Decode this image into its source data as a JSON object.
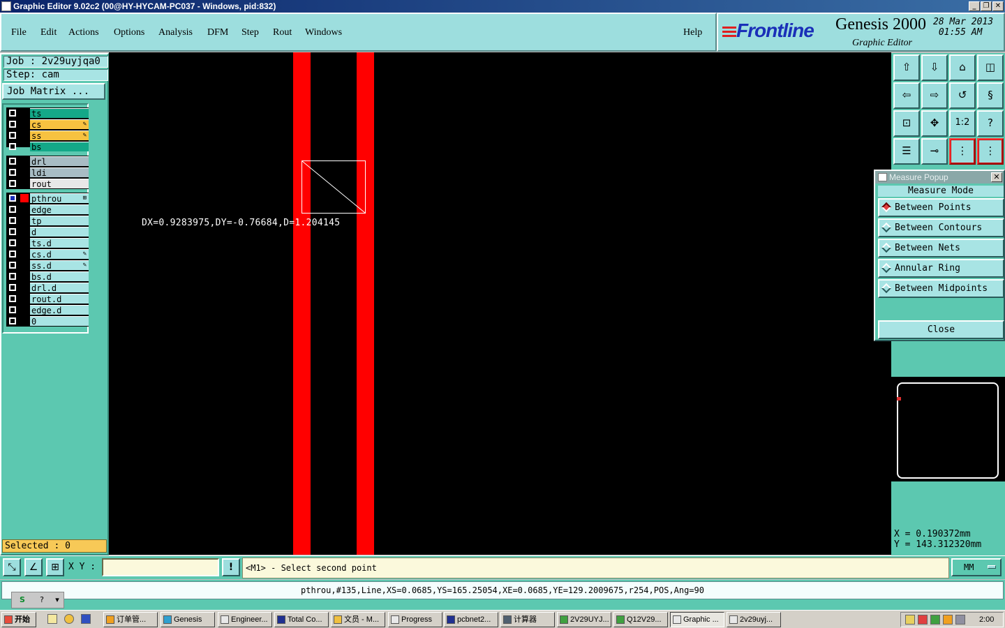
{
  "window": {
    "title": "Graphic Editor 9.02c2 (00@HY-HYCAM-PC037 - Windows, pid:832)"
  },
  "menu": {
    "items": [
      "File",
      "Edit",
      "Actions",
      "Options",
      "Analysis",
      "DFM",
      "Step",
      "Rout",
      "Windows"
    ],
    "help": "Help"
  },
  "brand": {
    "logo": "Frontline",
    "product": "Genesis 2000",
    "date": "28 Mar 2013",
    "time": "01:55 AM",
    "subtitle": "Graphic Editor"
  },
  "job": {
    "job_label": "Job : 2v29uyjqa0",
    "step_label": "Step: cam",
    "matrix_button": "Job Matrix ..."
  },
  "layers": {
    "group1": [
      {
        "name": "ts",
        "color": "#14a888",
        "mark": ""
      },
      {
        "name": "cs",
        "color": "#f7c240",
        "mark": "✎"
      },
      {
        "name": "ss",
        "color": "#f7c240",
        "mark": "✎"
      },
      {
        "name": "bs",
        "color": "#14a888",
        "mark": ""
      }
    ],
    "group2": [
      {
        "name": "drl",
        "color": "#a8bcc4",
        "mark": ""
      },
      {
        "name": "ldi",
        "color": "#a8bcc4",
        "mark": ""
      },
      {
        "name": "rout",
        "color": "#e8e8e8",
        "mark": ""
      }
    ],
    "group3": [
      {
        "name": "pthrou",
        "color": "#a8e4e4",
        "mark": "⊞"
      },
      {
        "name": "edge",
        "color": "#a8e4e4",
        "mark": ""
      },
      {
        "name": "tp",
        "color": "#a8e4e4",
        "mark": ""
      },
      {
        "name": "d",
        "color": "#a8e4e4",
        "mark": ""
      },
      {
        "name": "ts.d",
        "color": "#a8e4e4",
        "mark": ""
      },
      {
        "name": "cs.d",
        "color": "#a8e4e4",
        "mark": "✎"
      },
      {
        "name": "ss.d",
        "color": "#a8e4e4",
        "mark": "✎"
      },
      {
        "name": "bs.d",
        "color": "#a8e4e4",
        "mark": ""
      },
      {
        "name": "drl.d",
        "color": "#a8e4e4",
        "mark": ""
      },
      {
        "name": "rout.d",
        "color": "#a8e4e4",
        "mark": ""
      },
      {
        "name": "edge.d",
        "color": "#a8e4e4",
        "mark": ""
      },
      {
        "name": "0",
        "color": "#a8e4e4",
        "mark": ""
      }
    ]
  },
  "selected": "Selected : 0",
  "canvas": {
    "measure_text": "DX=0.9283975,DY=-0.76684,D=1.204145"
  },
  "measure_popup": {
    "title": "Measure Popup",
    "header": "Measure Mode",
    "options": [
      "Between Points",
      "Between Contours",
      "Between Nets",
      "Annular Ring",
      "Between Midpoints"
    ],
    "selected_index": 0,
    "close_label": "Close"
  },
  "coords": {
    "x": "X = 0.190372mm",
    "y": "Y = 143.312320mm"
  },
  "bottom": {
    "xy_label": "X Y :",
    "xy_value": "",
    "prompt": "<M1> - Select second point",
    "units": "MM",
    "status": "pthrou,#135,Line,XS=0.0685,YS=165.25054,XE=0.0685,YE=129.2009675,r254,POS,Ang=90"
  },
  "taskbar": {
    "start": "开始",
    "tasks": [
      "订单管...",
      "Genesis",
      "Engineer...",
      "Total Co...",
      "文员 - M...",
      "Progress",
      "pcbnet2...",
      "计算器",
      "2V29UYJ...",
      "Q12V29...",
      "Graphic ...",
      "2v29uyj..."
    ],
    "active_index": 10,
    "clock": "2:00"
  }
}
